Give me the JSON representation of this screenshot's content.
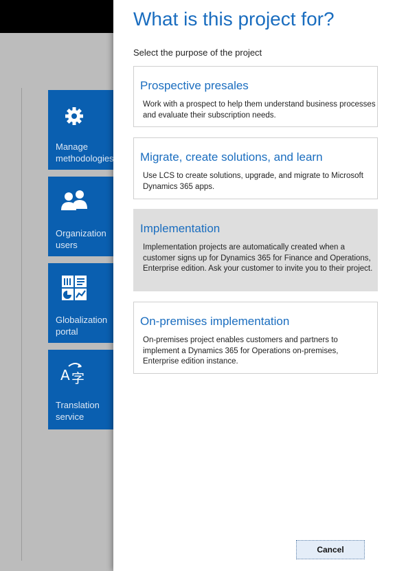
{
  "background": {
    "tiles": [
      {
        "label": "Manage\nmethodologies",
        "icon": "gear-icon"
      },
      {
        "label": "Organization\nusers",
        "icon": "users-icon"
      },
      {
        "label": "Globalization\nportal",
        "icon": "dashboard-grid-icon"
      },
      {
        "label": "Translation\nservice",
        "icon": "translate-icon"
      }
    ],
    "accent_color": "#0a5fb0"
  },
  "dialog": {
    "title": "What is this project for?",
    "subtitle": "Select the purpose of the project",
    "options": [
      {
        "title": "Prospective presales",
        "description": "Work with a prospect to help them understand business processes and evaluate their subscription needs.",
        "selected": false
      },
      {
        "title": "Migrate, create solutions, and learn",
        "description": "Use LCS to create solutions, upgrade, and migrate to Microsoft Dynamics 365 apps.",
        "selected": false
      },
      {
        "title": "Implementation",
        "description": "Implementation projects are automatically created when a customer signs up for Dynamics 365 for Finance and Operations, Enterprise edition. Ask your customer to invite you to their project.",
        "selected": true
      },
      {
        "title": "On-premises implementation",
        "description": "On-premises project enables customers and partners to implement a Dynamics 365 for Operations on-premises, Enterprise edition instance.",
        "selected": false
      }
    ],
    "cancel_label": "Cancel",
    "title_color": "#1a6dbf"
  }
}
